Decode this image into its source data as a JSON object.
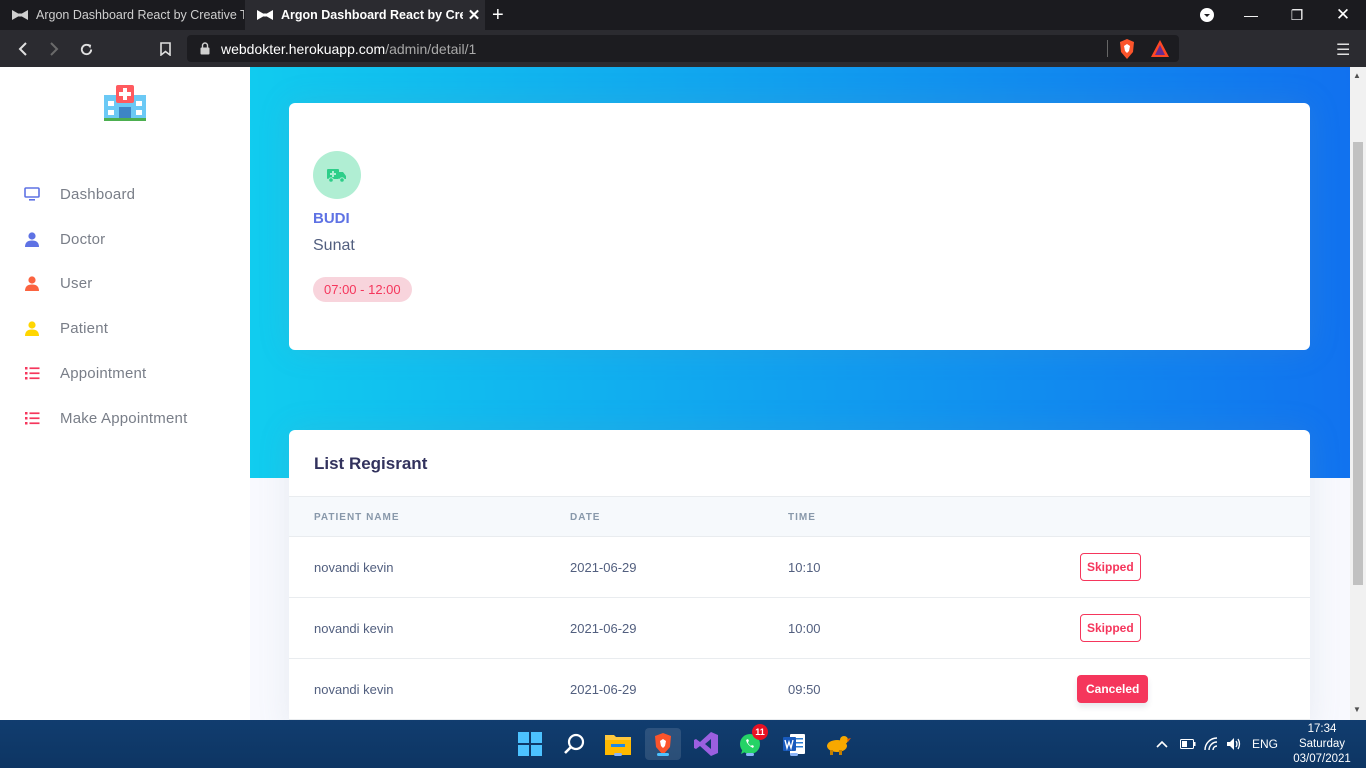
{
  "browser": {
    "tabs": [
      {
        "title": "Argon Dashboard React by Creative Tim",
        "active": false
      },
      {
        "title": "Argon Dashboard React by Creative Tim",
        "active": true
      }
    ],
    "url_host": "webdokter.herokuapp.com",
    "url_path": "/admin/detail/1"
  },
  "sidebar": {
    "items": [
      {
        "label": "Dashboard",
        "icon": "monitor-icon",
        "color": "#5e72e4"
      },
      {
        "label": "Doctor",
        "icon": "user-icon",
        "color": "#5e72e4"
      },
      {
        "label": "User",
        "icon": "user-icon",
        "color": "#fb6340"
      },
      {
        "label": "Patient",
        "icon": "user-icon",
        "color": "#ffd600"
      },
      {
        "label": "Appointment",
        "icon": "list-icon",
        "color": "#f5365c"
      },
      {
        "label": "Make Appointment",
        "icon": "list-icon",
        "color": "#f5365c"
      }
    ]
  },
  "doctor": {
    "name": "BUDI",
    "specialty": "Sunat",
    "schedule": "07:00 - 12:00"
  },
  "registrants": {
    "title": "List Regisrant",
    "columns": [
      "PATIENT NAME",
      "DATE",
      "TIME"
    ],
    "rows": [
      {
        "name": "novandi kevin",
        "date": "2021-06-29",
        "time": "10:10",
        "status": "Skipped"
      },
      {
        "name": "novandi kevin",
        "date": "2021-06-29",
        "time": "10:00",
        "status": "Skipped"
      },
      {
        "name": "novandi kevin",
        "date": "2021-06-29",
        "time": "09:50",
        "status": "Canceled"
      }
    ]
  },
  "taskbar": {
    "whatsapp_badge": "11",
    "lang": "ENG",
    "time": "17:34",
    "day": "Saturday",
    "date": "03/07/2021"
  },
  "colors": {
    "primary": "#5e72e4",
    "danger": "#f5365c",
    "gradient_start": "#11cdef",
    "gradient_end": "#1171ef"
  }
}
